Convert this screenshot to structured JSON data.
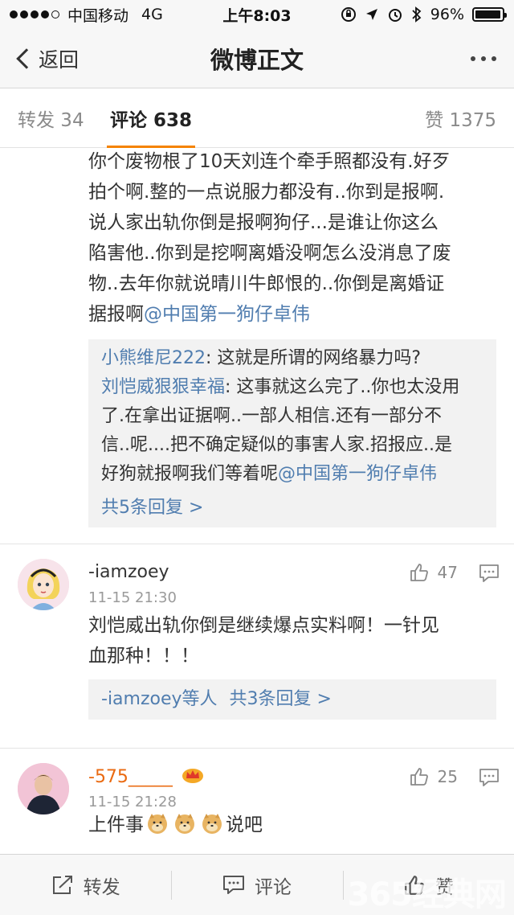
{
  "status_bar": {
    "carrier": "中国移动",
    "network": "4G",
    "time": "上午8:03",
    "battery": "96%",
    "battery_level": 0.96
  },
  "nav": {
    "back_label": "返回",
    "title": "微博正文"
  },
  "tabs": {
    "repost": "转发 34",
    "comment": "评论 638",
    "like": "赞 1375"
  },
  "comments": [
    {
      "lines": [
        "你个废物根了10天刘连个牵手照都没有.好歹",
        "拍个啊.整的一点说服力都没有..你到是报啊.",
        "说人家出轨你倒是报啊狗仔...是谁让你这么",
        "陷害他..你到是挖啊离婚没啊怎么没消息了废",
        "物..去年你就说晴川牛郎恨的..你倒是离婚证"
      ],
      "last_line_prefix": "据报啊",
      "last_line_mention": "@中国第一狗仔卓伟",
      "replies": {
        "r1_user": "小熊维尼222",
        "r1_text": ": 这就是所谓的网络暴力吗?",
        "r2_user": "刘恺威狠狠幸福",
        "r2_line1": ": 这事就这么完了..你也太没用",
        "r2_line2": "了.在拿出证据啊..一部人相信.还有一部分不",
        "r2_line3": "信..呢....把不确定疑似的事害人家.招报应..是",
        "r2_line4_prefix": "好狗就报啊我们等着呢",
        "r2_line4_mention": "@中国第一狗仔卓伟",
        "more": "共5条回复 >"
      }
    },
    {
      "user": "-iamzoey",
      "time": "11-15 21:30",
      "likes": "47",
      "text_line1": "刘恺威出轨你倒是继续爆点实料啊！一针见",
      "text_line2": "血那种！！！",
      "reply_users": "-iamzoey等人",
      "reply_more": "共3条回复 >"
    },
    {
      "user": "-575_____",
      "time": "11-15 21:28",
      "likes": "25",
      "text_prefix": "上件事",
      "text_suffix": "说吧"
    }
  ],
  "toolbar": {
    "repost": "转发",
    "comment": "评论",
    "like": "赞"
  },
  "watermark": "365经典网",
  "colors": {
    "accent_orange": "#f58300",
    "link_blue": "#507daf",
    "username_orange": "#ea6a11"
  }
}
